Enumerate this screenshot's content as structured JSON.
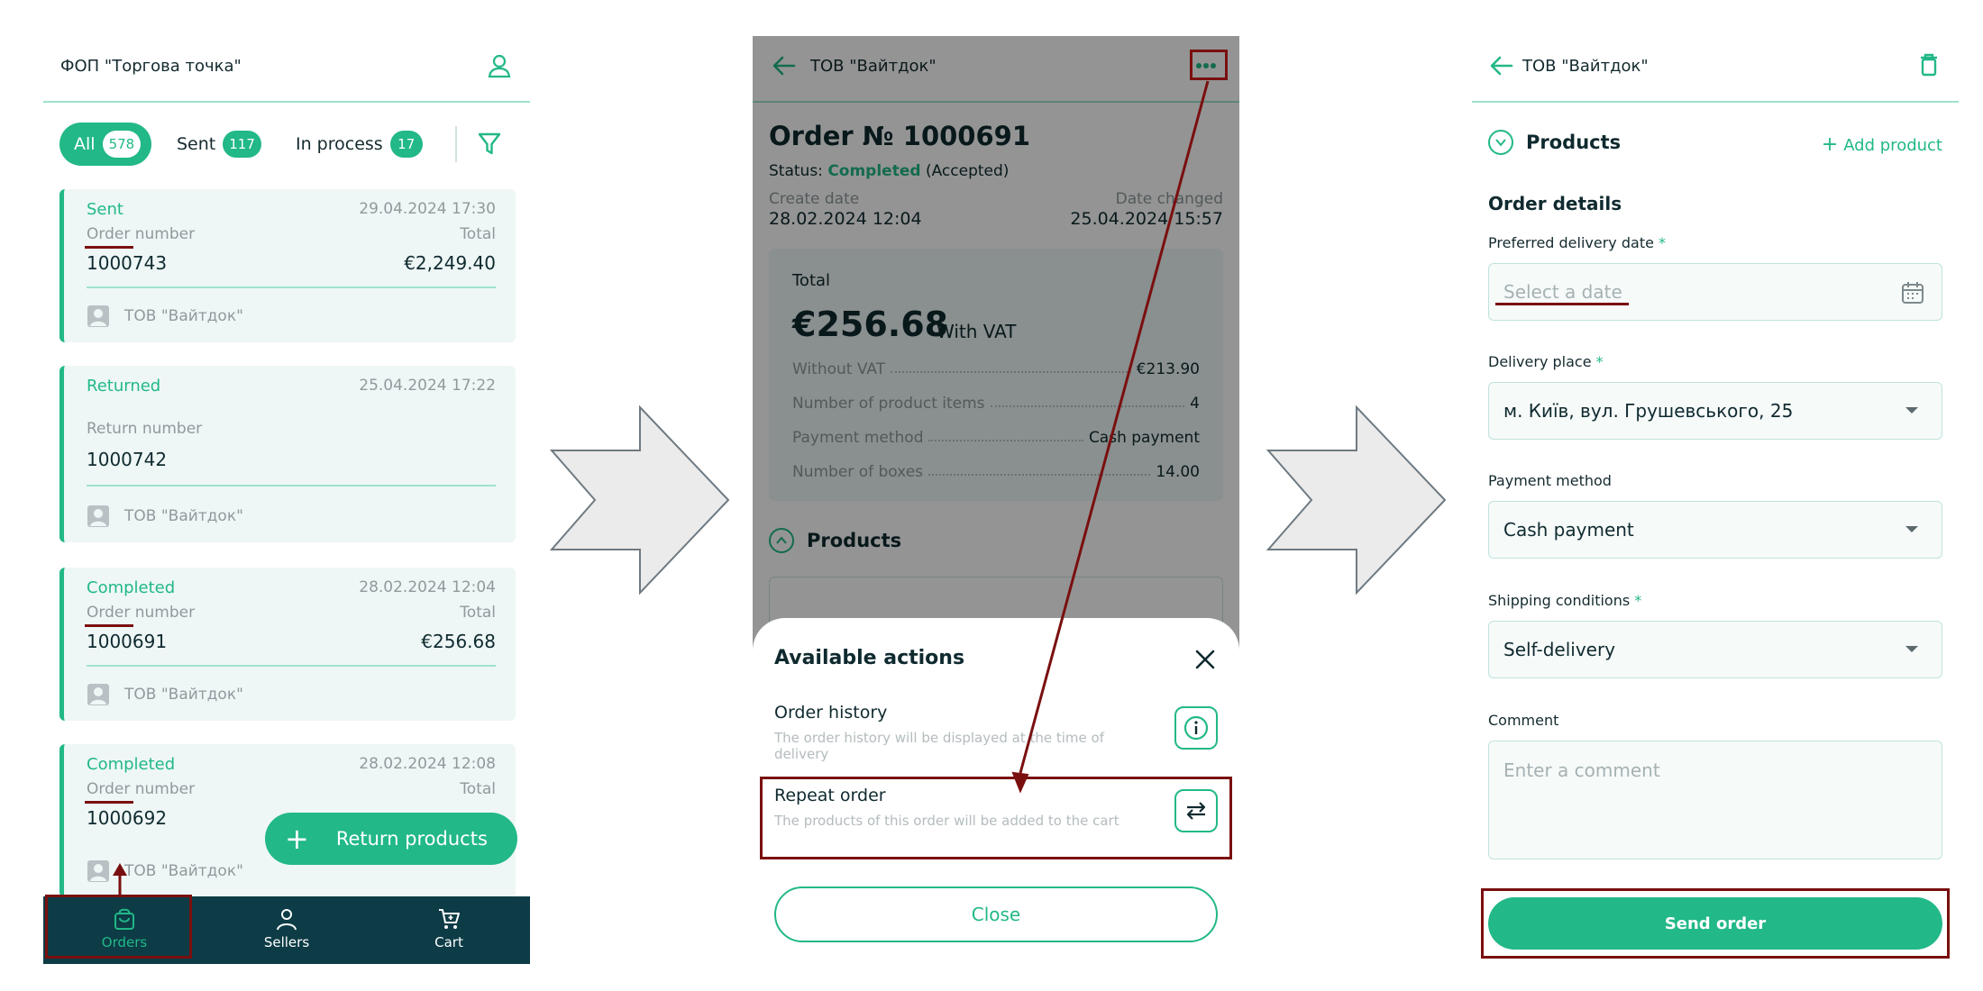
{
  "screen1": {
    "header_title": "ФОП \"Торгова точка\"",
    "filters": [
      {
        "label": "All",
        "count": "578"
      },
      {
        "label": "Sent",
        "count": "117"
      },
      {
        "label": "In process",
        "count": "17"
      }
    ],
    "cards": [
      {
        "status": "Sent",
        "date": "29.04.2024 17:30",
        "number_label": "Order number",
        "total_label": "Total",
        "number": "1000743",
        "total": "€2,249.40",
        "seller": "ТОВ \"Вайтдок\""
      },
      {
        "status": "Returned",
        "date": "25.04.2024 17:22",
        "number_label": "Return number",
        "number": "1000742",
        "seller": "ТОВ \"Вайтдок\""
      },
      {
        "status": "Completed",
        "date": "28.02.2024 12:04",
        "number_label": "Order number",
        "total_label": "Total",
        "number": "1000691",
        "total": "€256.68",
        "seller": "ТОВ \"Вайтдок\""
      },
      {
        "status": "Completed",
        "date": "28.02.2024 12:08",
        "number_label": "Order number",
        "total_label": "Total",
        "number": "1000692",
        "seller": "ТОВ \"Вайтдок\""
      }
    ],
    "fab_label": "Return products",
    "nav": {
      "orders": "Orders",
      "sellers": "Sellers",
      "cart": "Cart"
    }
  },
  "screen2": {
    "header_title": "ТОВ \"Вайтдок\"",
    "order_title": "Order № 1000691",
    "status_prefix": "Status:",
    "status_value": "Completed",
    "status_suffix": "(Accepted)",
    "create_date_label": "Create date",
    "create_date": "28.02.2024 12:04",
    "date_changed_label": "Date changed",
    "date_changed": "25.04.2024 15:57",
    "total_label": "Total",
    "total_amount": "€256.68",
    "vat_label": "With VAT",
    "rows": [
      {
        "label": "Without VAT",
        "value": "€213.90"
      },
      {
        "label": "Number of product items",
        "value": "4"
      },
      {
        "label": "Payment method",
        "value": "Cash payment"
      },
      {
        "label": "Number of boxes",
        "value": "14.00"
      }
    ],
    "products_label": "Products",
    "sheet": {
      "title": "Available actions",
      "actions": [
        {
          "title": "Order history",
          "desc": "The order history will be displayed at the time of delivery"
        },
        {
          "title": "Repeat order",
          "desc": "The products of this order will be added to the cart"
        }
      ],
      "close_label": "Close"
    }
  },
  "screen3": {
    "header_title": "ТОВ \"Вайтдок\"",
    "products_label": "Products",
    "add_product_label": "Add product",
    "order_details_label": "Order details",
    "fields": {
      "delivery_date": {
        "label": "Preferred delivery date",
        "placeholder": "Select a date"
      },
      "delivery_place": {
        "label": "Delivery place",
        "value": "м. Київ, вул. Грушевського, 25"
      },
      "payment_method": {
        "label": "Payment method",
        "value": "Cash payment"
      },
      "shipping": {
        "label": "Shipping conditions",
        "value": "Self-delivery"
      },
      "comment": {
        "label": "Comment",
        "placeholder": "Enter a comment"
      }
    },
    "required_mark": "*",
    "send_label": "Send order"
  },
  "colors": {
    "accent": "#22b888",
    "navbar": "#0d3c46",
    "highlight": "#7a0f0f",
    "card_bg": "#eef7f6"
  }
}
